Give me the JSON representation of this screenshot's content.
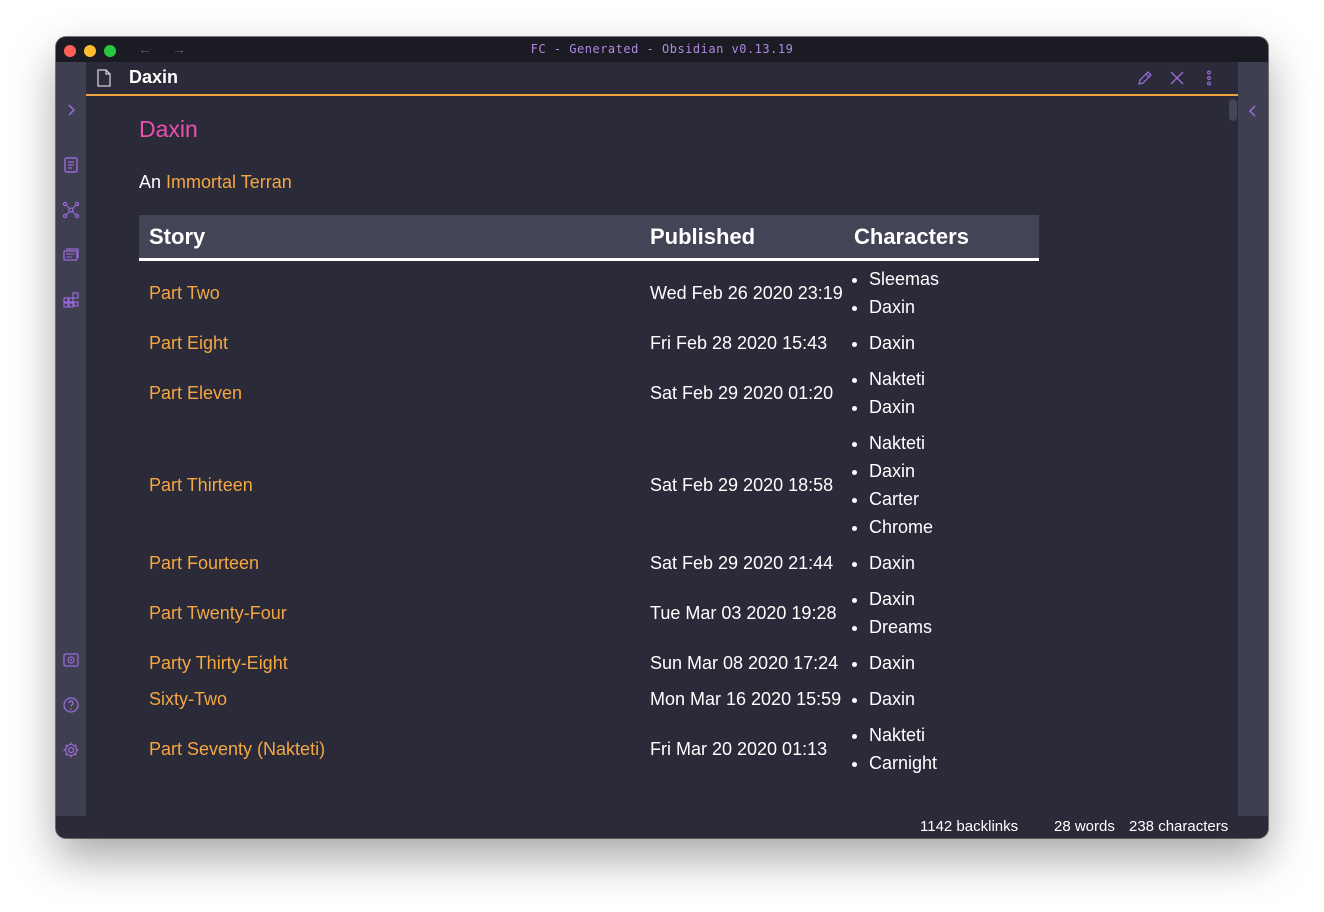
{
  "window": {
    "title": "FC - Generated - Obsidian v0.13.19",
    "back_arrow": "←",
    "forward_arrow": "→"
  },
  "header": {
    "note_title": "Daxin"
  },
  "ribbon": {
    "icons": [
      "collapse-left-sidebar-icon",
      "quick-switcher-icon",
      "graph-view-icon",
      "templates-icon",
      "plugins-grid-icon",
      "vault-icon",
      "help-icon",
      "settings-icon"
    ]
  },
  "note": {
    "title": "Daxin",
    "intro_prefix": "An",
    "intro_link": "Immortal Terran",
    "table": {
      "headers": [
        "Story",
        "Published",
        "Characters"
      ],
      "rows": [
        {
          "story": "Part Two",
          "published": "Wed Feb 26 2020 23:19",
          "characters": [
            "Sleemas",
            "Daxin"
          ]
        },
        {
          "story": "Part Eight",
          "published": "Fri Feb 28 2020 15:43",
          "characters": [
            "Daxin"
          ]
        },
        {
          "story": "Part Eleven",
          "published": "Sat Feb 29 2020 01:20",
          "characters": [
            "Nakteti",
            "Daxin"
          ]
        },
        {
          "story": "Part Thirteen",
          "published": "Sat Feb 29 2020 18:58",
          "characters": [
            "Nakteti",
            "Daxin",
            "Carter",
            "Chrome"
          ]
        },
        {
          "story": "Part Fourteen",
          "published": "Sat Feb 29 2020 21:44",
          "characters": [
            "Daxin"
          ]
        },
        {
          "story": "Part Twenty-Four",
          "published": "Tue Mar 03 2020 19:28",
          "characters": [
            "Daxin",
            "Dreams"
          ]
        },
        {
          "story": "Party Thirty-Eight",
          "published": "Sun Mar 08 2020 17:24",
          "characters": [
            "Daxin"
          ]
        },
        {
          "story": "Sixty-Two",
          "published": "Mon Mar 16 2020 15:59",
          "characters": [
            "Daxin"
          ]
        },
        {
          "story": "Part Seventy (Nakteti)",
          "published": "Fri Mar 20 2020 01:13",
          "characters": [
            "Nakteti",
            "Carnight"
          ]
        }
      ]
    }
  },
  "status": {
    "backlinks": "1142 backlinks",
    "words": "28 words",
    "characters": "238 characters"
  },
  "colors": {
    "accent_orange": "#f5a742",
    "title_pink": "#ec4fae",
    "background": "#2a2a38",
    "ribbon": "#3f3f52",
    "icon_purple": "#9b6ad8"
  }
}
